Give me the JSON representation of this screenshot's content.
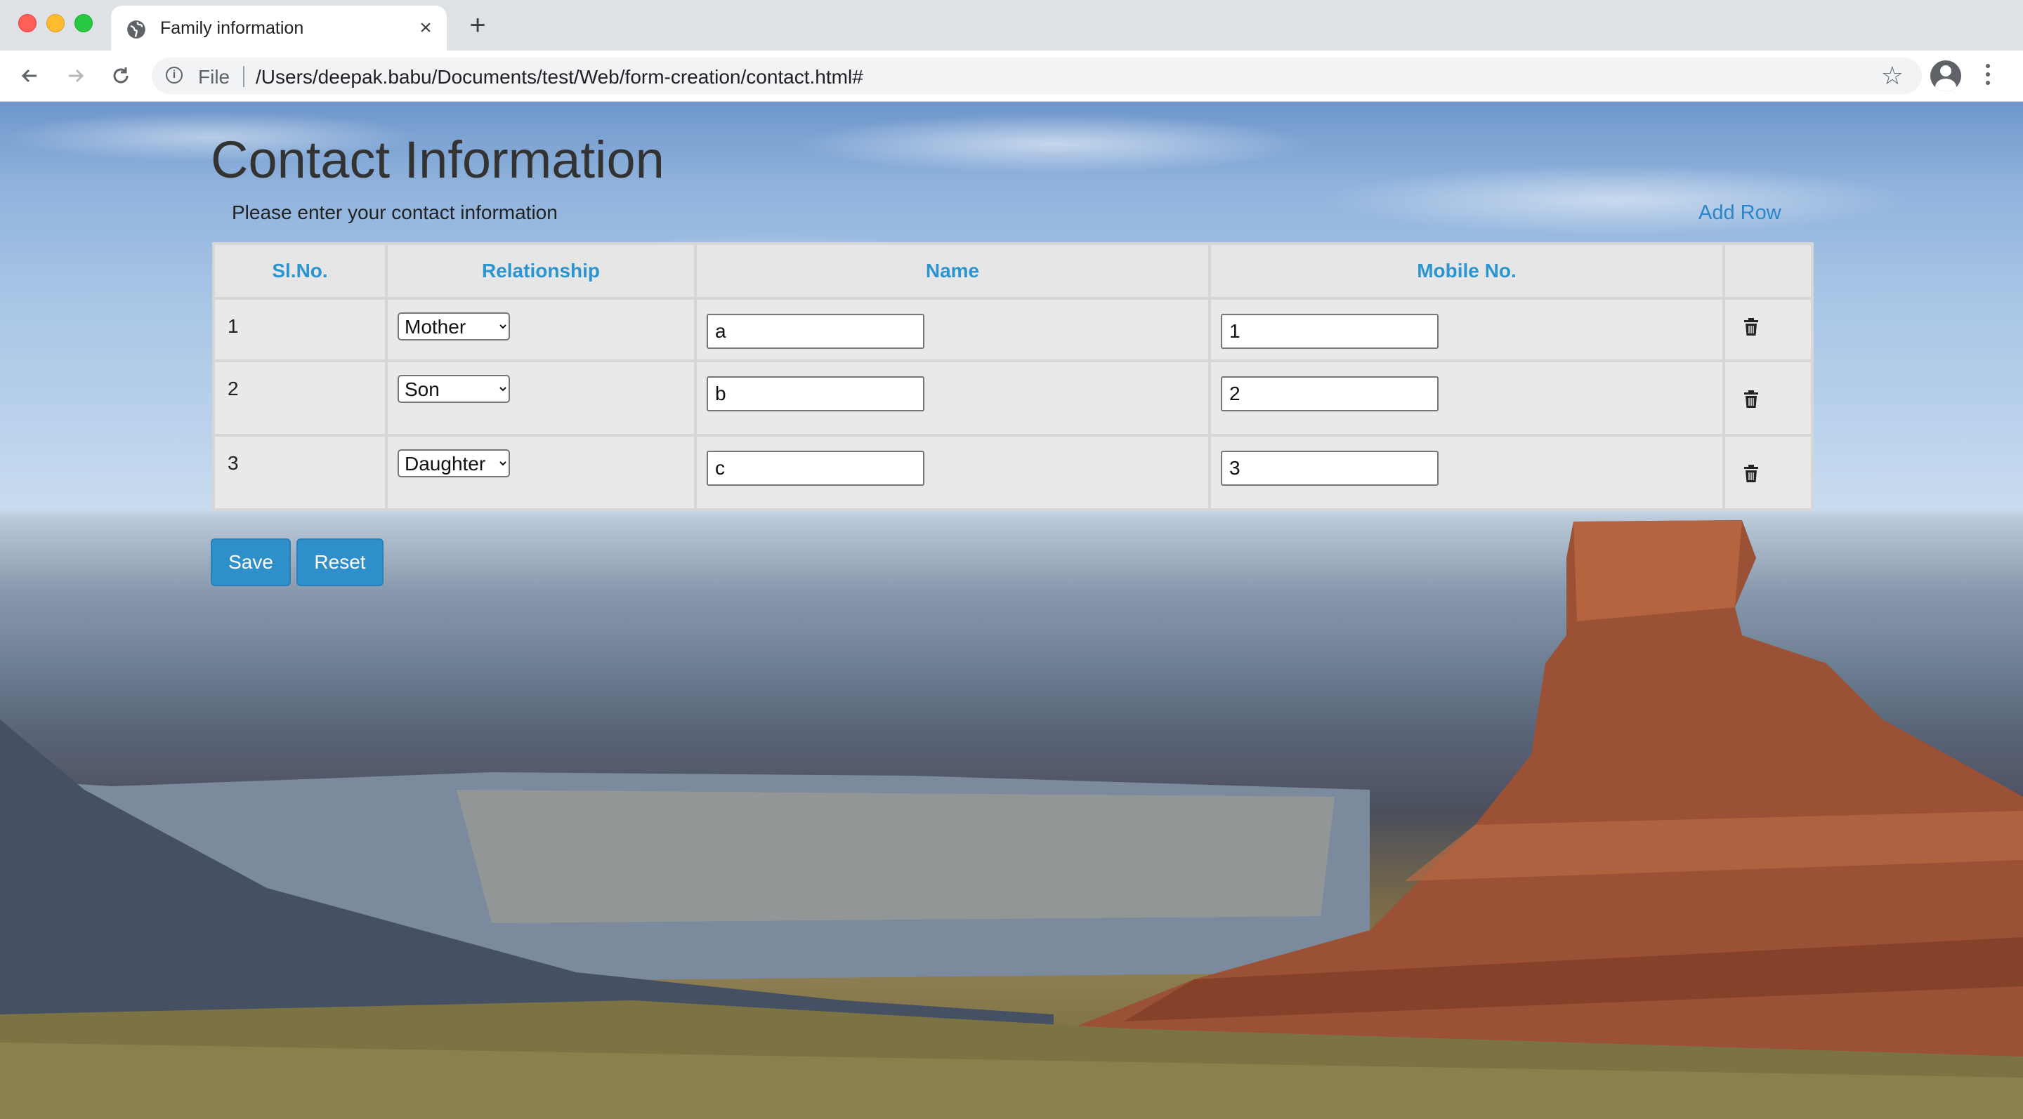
{
  "browser": {
    "tab_title": "Family information",
    "tab_close": "×",
    "new_tab": "+",
    "scheme": "File",
    "url": "/Users/deepak.babu/Documents/test/Web/form-creation/contact.html#",
    "icons": [
      "globe-icon",
      "close-icon",
      "plus-icon",
      "back-icon",
      "forward-icon",
      "reload-icon",
      "info-icon",
      "star-icon",
      "avatar-icon",
      "menu-icon"
    ]
  },
  "page": {
    "title": "Contact Information",
    "subtitle": "Please enter your contact information",
    "add_row": "Add Row",
    "accent_color": "#2f8fcb",
    "background": "canyon landscape photo"
  },
  "table": {
    "headers": [
      "Sl.No.",
      "Relationship",
      "Name",
      "Mobile No.",
      ""
    ],
    "relationship_options": [
      "Mother",
      "Son",
      "Daughter"
    ],
    "rows": [
      {
        "num": "1",
        "relationship": "Mother",
        "name": "a",
        "mobile": "1"
      },
      {
        "num": "2",
        "relationship": "Son",
        "name": "b",
        "mobile": "2"
      },
      {
        "num": "3",
        "relationship": "Daughter",
        "name": "c",
        "mobile": "3"
      }
    ]
  },
  "buttons": {
    "save": "Save",
    "reset": "Reset"
  }
}
